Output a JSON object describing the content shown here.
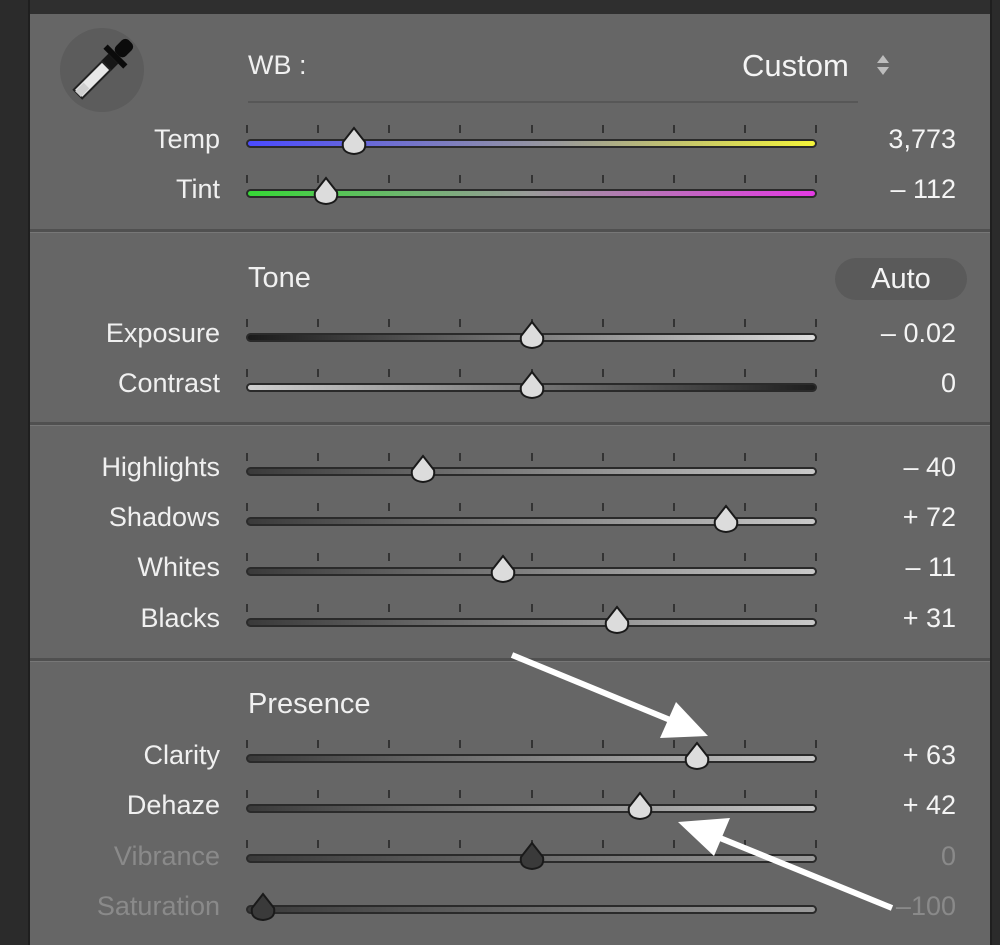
{
  "wb": {
    "label": "WB :",
    "value": "Custom",
    "sliders": [
      {
        "label": "Temp",
        "value": "3,773",
        "position": 0.19
      },
      {
        "label": "Tint",
        "value": "– 112",
        "position": 0.14
      }
    ]
  },
  "tone": {
    "title": "Tone",
    "auto_label": "Auto",
    "sliders": [
      {
        "label": "Exposure",
        "value": "– 0.02",
        "position": 0.5
      },
      {
        "label": "Contrast",
        "value": "0",
        "position": 0.5
      }
    ],
    "sliders2": [
      {
        "label": "Highlights",
        "value": "– 40",
        "position": 0.31
      },
      {
        "label": "Shadows",
        "value": "+ 72",
        "position": 0.84
      },
      {
        "label": "Whites",
        "value": "– 11",
        "position": 0.45
      },
      {
        "label": "Blacks",
        "value": "+ 31",
        "position": 0.65
      }
    ]
  },
  "presence": {
    "title": "Presence",
    "sliders": [
      {
        "label": "Clarity",
        "value": "+ 63",
        "position": 0.79
      },
      {
        "label": "Dehaze",
        "value": "+ 42",
        "position": 0.69
      },
      {
        "label": "Vibrance",
        "value": "0",
        "position": 0.5
      },
      {
        "label": "Saturation",
        "value": "–100",
        "position": 0.03
      }
    ]
  },
  "colors": {
    "panel_bg": "#666666",
    "temp_start": "#4a4aff",
    "temp_end": "#f4f43a",
    "tint_start": "#36d836",
    "tint_end": "#e43ae4"
  }
}
